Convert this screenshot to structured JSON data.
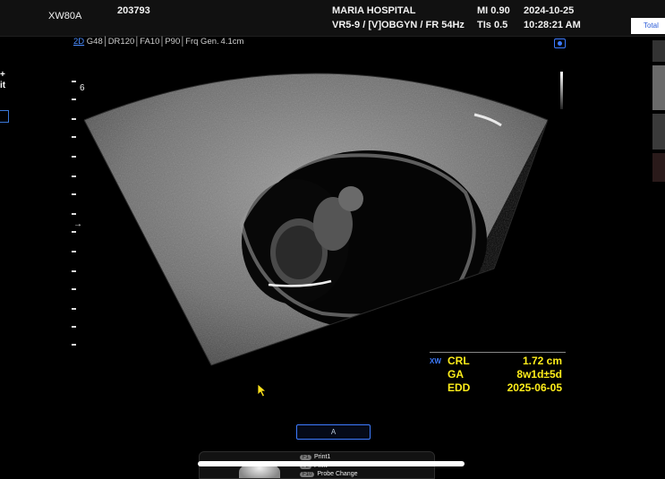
{
  "header": {
    "model": "XW80A",
    "patient_id": "203793",
    "hospital": "MARIA HOSPITAL",
    "probe_preset": "VR5-9 / [V]OBGYN / FR 54Hz",
    "mi": "MI  0.90",
    "tis": "TIs 0.5",
    "date": "2024-10-25",
    "time": "10:28:21 AM",
    "total_tab": "Total"
  },
  "imaging": {
    "mode": "2D",
    "params": " G48│DR120│FA10│P90│Frq Gen. 4.1cm",
    "depth_label": "6",
    "focus_marker": "→",
    "left_marks": [
      "+",
      "it"
    ]
  },
  "measurements": {
    "vendor_tag": "XW",
    "rows": [
      {
        "label": "CRL",
        "value": "1.72 cm"
      },
      {
        "label": "GA",
        "value": "8w1d±5d"
      },
      {
        "label": "EDD",
        "value": "2025-06-05"
      }
    ]
  },
  "bottom": {
    "button_label": "A",
    "menu": [
      {
        "key": "F1",
        "label": "Print1"
      },
      {
        "key": "F2",
        "label": "Print"
      },
      {
        "key": "F10",
        "label": "Probe Change"
      }
    ]
  },
  "colors": {
    "accent": "#3d7bff",
    "measure": "#ffee1a"
  }
}
